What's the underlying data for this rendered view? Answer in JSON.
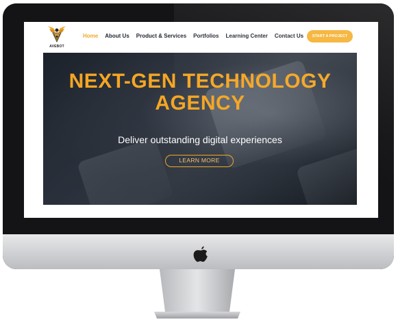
{
  "site": {
    "logo_text": "AVEBOT",
    "nav": {
      "items": [
        {
          "label": "Home",
          "active": true
        },
        {
          "label": "About Us",
          "active": false
        },
        {
          "label": "Product & Services",
          "active": false
        },
        {
          "label": "Portfolios",
          "active": false
        },
        {
          "label": "Learning Center",
          "active": false
        },
        {
          "label": "Contact Us",
          "active": false
        }
      ],
      "cta_label": "START A PROJECT"
    },
    "hero": {
      "title_line1": "NEXT-GEN TECHNOLOGY",
      "title_line2": "AGENCY",
      "subtitle": "Deliver outstanding digital experiences",
      "button_label": "LEARN MORE"
    }
  },
  "colors": {
    "accent": "#f5a623",
    "cta_bg": "#f5b335",
    "nav_text": "#1f2430",
    "hero_text": "#ffffff"
  },
  "icons": {
    "logo": "eagle-logo-icon",
    "apple": "apple-logo-icon"
  }
}
